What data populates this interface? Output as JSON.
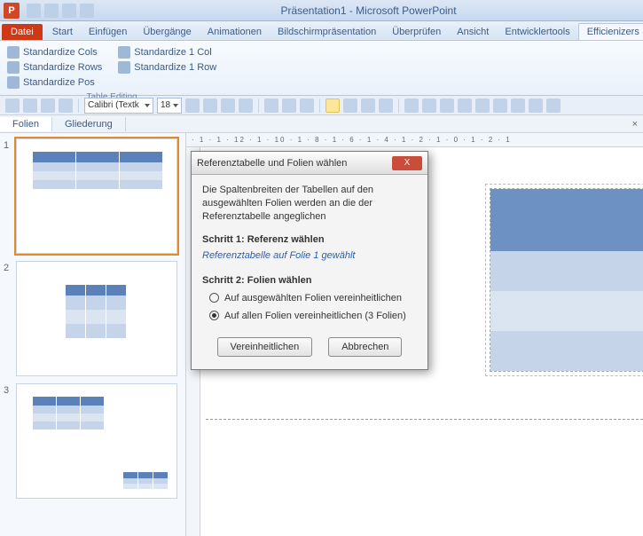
{
  "titlebar": {
    "app_letter": "P",
    "title": "Präsentation1 - Microsoft PowerPoint"
  },
  "tabs": {
    "file": "Datei",
    "items": [
      "Start",
      "Einfügen",
      "Übergänge",
      "Animationen",
      "Bildschirmpräsentation",
      "Überprüfen",
      "Ansicht",
      "Entwicklertools",
      "Efficienizers"
    ],
    "active_index": 8
  },
  "ribbon": {
    "buttons": {
      "std_cols": "Standardize Cols",
      "std_rows": "Standardize Rows",
      "std_pos": "Standardize Pos",
      "std_1col": "Standardize 1 Col",
      "std_1row": "Standardize 1 Row"
    },
    "group_label": "Table Editing"
  },
  "minibar": {
    "font": "Calibri (Textk",
    "size": "18"
  },
  "panel": {
    "tab_slides": "Folien",
    "tab_outline": "Gliederung"
  },
  "thumbs": {
    "numbers": [
      "1",
      "2",
      "3"
    ]
  },
  "ruler": {
    "marks": "· 1 · 1 · 12 · 1 · 10 · 1 · 8 · 1 · 6 · 1 · 4 · 1 · 2 · 1 · 0 · 1 · 2 · 1"
  },
  "dialog": {
    "title": "Referenztabelle und Folien wählen",
    "close": "X",
    "desc": "Die Spaltenbreiten der Tabellen auf den ausgewählten Folien werden an die der Referenztabelle angeglichen",
    "step1": "Schritt 1: Referenz wählen",
    "ref": "Referenztabelle auf Folie 1 gewählt",
    "step2": "Schritt 2: Folien wählen",
    "opt1": "Auf ausgewählten Folien vereinheitlichen",
    "opt2": "Auf allen Folien vereinheitlichen (3 Folien)",
    "ok": "Vereinheitlichen",
    "cancel": "Abbrechen"
  }
}
